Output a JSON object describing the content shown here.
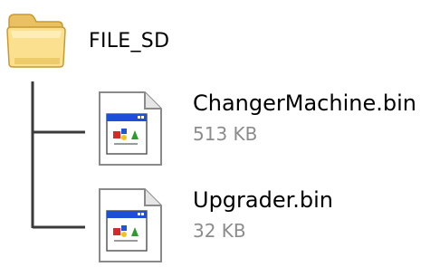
{
  "folder": {
    "name": "FILE_SD",
    "icon": "folder-icon"
  },
  "files": [
    {
      "name": "ChangerMachine.bin",
      "size": "513 KB",
      "icon": "application-window-icon"
    },
    {
      "name": "Upgrader.bin",
      "size": "32 KB",
      "icon": "application-window-icon"
    }
  ],
  "colors": {
    "folder_light": "#FBE08F",
    "folder_dark": "#E2B23F",
    "tree_line": "#3a3a3a",
    "size_text": "#8c8c8c"
  }
}
